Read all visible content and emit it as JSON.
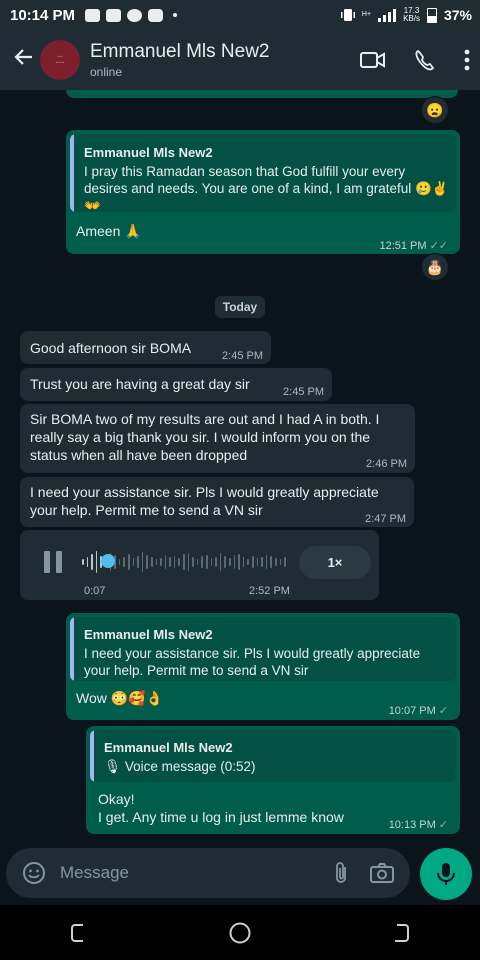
{
  "status_bar": {
    "time": "10:14 PM",
    "network_speed": "17.3",
    "network_unit": "KB/s",
    "net_type": "H+",
    "battery": "37%"
  },
  "header": {
    "contact_name": "Emmanuel Mls New2",
    "status": "online"
  },
  "date_chip": "Today",
  "messages": {
    "m1": {
      "reaction": "😦"
    },
    "m2": {
      "quote_name": "Emmanuel Mls New2",
      "quote_text": "I pray this Ramadan season that God fulfill your every desires and needs. You are one of a kind, I am grateful 🥲✌️👐",
      "text": "Ameen 🙏",
      "time": "12:51 PM",
      "reaction": "🎂"
    },
    "m3": {
      "text": "Good afternoon sir BOMA",
      "time": "2:45 PM"
    },
    "m4": {
      "text": "Trust you are having a great day sir",
      "time": "2:45 PM"
    },
    "m5": {
      "text": "Sir BOMA two of my results are out and I had A in both. I really say a big thank you sir. I would inform you on the status when all have been dropped",
      "time": "2:46 PM"
    },
    "m6": {
      "text": "I need your assistance sir. Pls I would greatly appreciate your help. Permit me to send a VN sir",
      "time": "2:47 PM"
    },
    "voice": {
      "duration": "0:07",
      "time": "2:52 PM",
      "speed": "1×",
      "progress": 0.1
    },
    "m7": {
      "quote_name": "Emmanuel Mls New2",
      "quote_text": "I need your assistance sir. Pls I would greatly appreciate your help. Permit me to send a VN sir",
      "text": "Wow 😳🥰👌",
      "time": "10:07 PM"
    },
    "m8": {
      "quote_name": "Emmanuel Mls New2",
      "quote_text": "Voice message (0:52)",
      "line1": "Okay!",
      "line2": "I get. Any time u log in just lemme know",
      "time": "10:13 PM"
    }
  },
  "input": {
    "placeholder": "Message"
  },
  "colors": {
    "incoming": "#1f2c34",
    "outgoing": "#005c4b",
    "accent": "#00a884",
    "background": "#0b141a"
  }
}
